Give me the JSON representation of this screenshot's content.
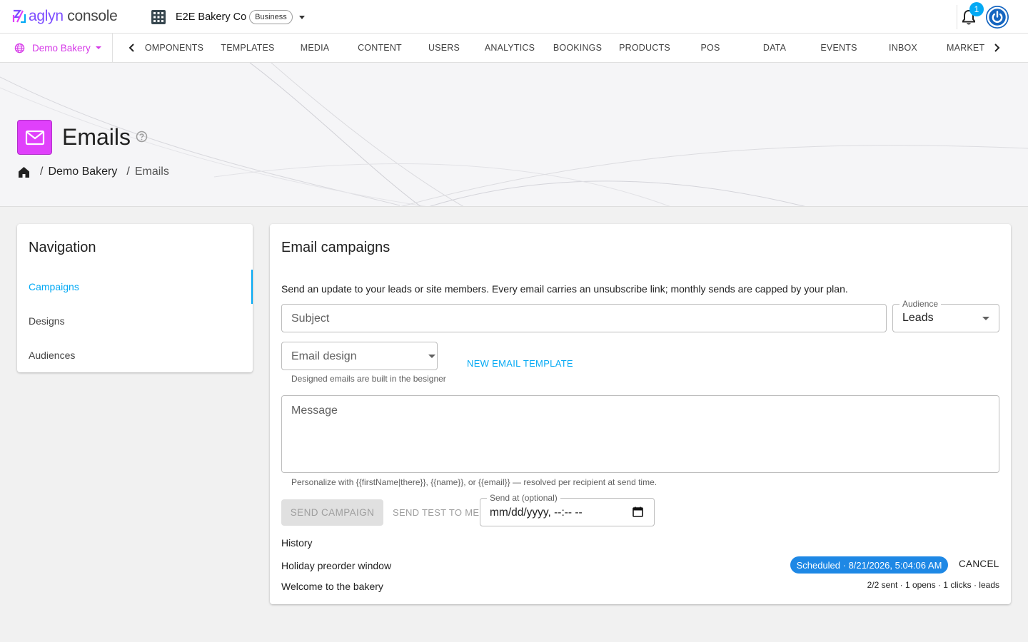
{
  "brand": {
    "name_part1": "aglyn",
    "name_part2": " console"
  },
  "org": {
    "name": "E2E Bakery Co",
    "plan_badge": "Business"
  },
  "notifications": {
    "count": "1"
  },
  "site_selector": {
    "label": "Demo Bakery"
  },
  "nav_tabs": [
    "OMPONENTS",
    "TEMPLATES",
    "MEDIA",
    "CONTENT",
    "USERS",
    "ANALYTICS",
    "BOOKINGS",
    "PRODUCTS",
    "POS",
    "DATA",
    "EVENTS",
    "INBOX",
    "MARKETI"
  ],
  "page": {
    "title": "Emails",
    "breadcrumb": {
      "site": "Demo Bakery",
      "current": "Emails",
      "separator": "/"
    }
  },
  "side_nav": {
    "title": "Navigation",
    "items": [
      "Campaigns",
      "Designs",
      "Audiences"
    ],
    "active": "Campaigns"
  },
  "campaigns": {
    "title": "Email campaigns",
    "intro": "Send an update to your leads or site members. Every email carries an unsubscribe link; monthly sends are capped by your plan.",
    "subject_placeholder": "Subject",
    "audience": {
      "label": "Audience",
      "value": "Leads"
    },
    "email_design": {
      "placeholder": "Email design",
      "helper": "Designed emails are built in the besigner"
    },
    "new_template_label": "NEW EMAIL TEMPLATE",
    "message_placeholder": "Message",
    "personalize_hint": "Personalize with {{firstName|there}}, {{name}}, or {{email}} — resolved per recipient at send time.",
    "send_button": "SEND CAMPAIGN",
    "send_test_button": "SEND TEST TO ME",
    "send_at": {
      "label": "Send at (optional)",
      "value": "mm/dd/yyyy, --:-- --"
    },
    "history": {
      "title": "History",
      "items": [
        {
          "name": "Holiday preorder window",
          "status": "Scheduled · 8/21/2026, 5:04:06 AM",
          "action": "CANCEL"
        },
        {
          "name": "Welcome to the bakery",
          "stats": "2/2 sent · 1 opens · 1 clicks · leads"
        }
      ]
    }
  },
  "colors": {
    "accent": "#03a9f4",
    "brand_purple": "#7c4dff",
    "site_pink": "#d63be8",
    "page_icon_bg": "#e040fb",
    "status_chip": "#1e88e5",
    "avatar_blue": "#1565c0"
  },
  "icons": {
    "logo": "aglyn-logo-icon",
    "org": "building-icon",
    "notifications": "bell-icon",
    "account": "power-icon",
    "site": "globe-icon",
    "page": "mail-icon",
    "help": "help-circle-icon",
    "home": "home-icon",
    "date": "calendar-icon"
  }
}
